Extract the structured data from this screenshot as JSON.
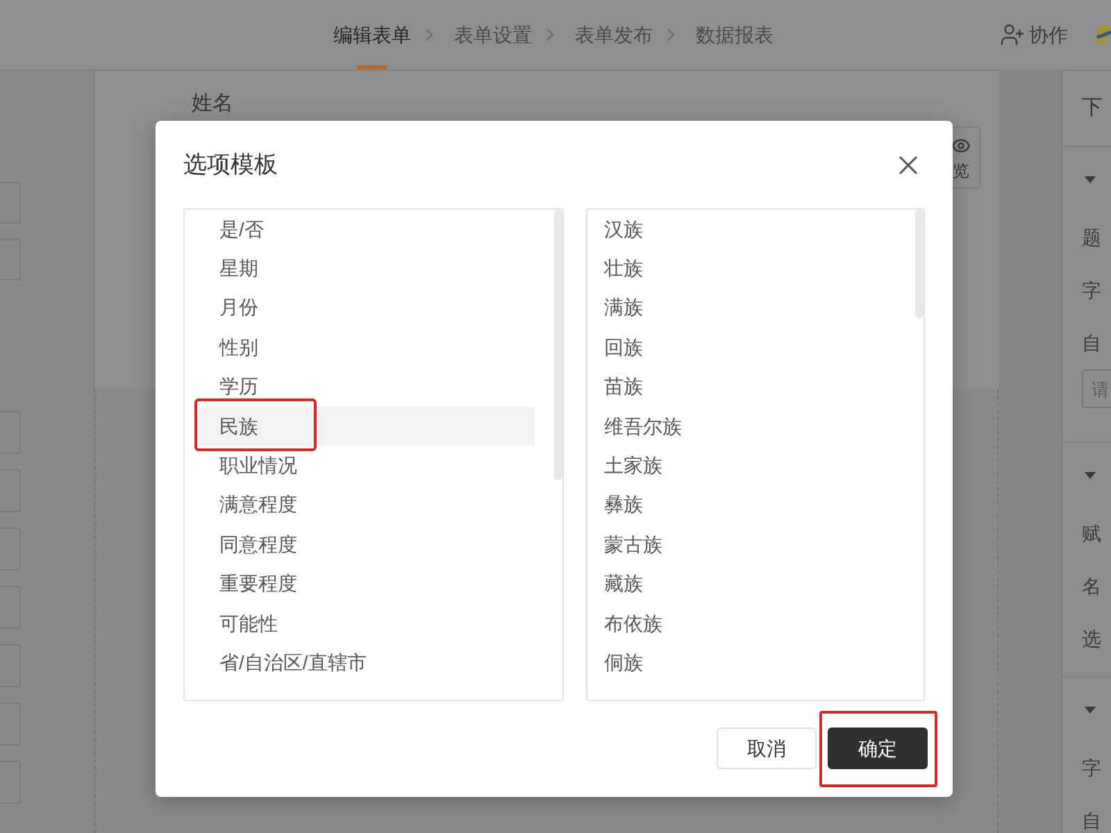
{
  "top_bar": {
    "steps": [
      {
        "label": "编辑表单",
        "selected": true
      },
      {
        "label": "表单设置",
        "selected": false
      },
      {
        "label": "表单发布",
        "selected": false
      },
      {
        "label": "数据报表",
        "selected": false
      }
    ],
    "collaborate_button": "协作"
  },
  "form_canvas": {
    "field_label": "姓名",
    "preview_button": "览"
  },
  "properties_panel": {
    "title": "下",
    "sections": [
      {
        "expanded": true,
        "rows": [
          {
            "kind": "label",
            "text": "题"
          },
          {
            "kind": "label",
            "text": "字"
          },
          {
            "kind": "label",
            "text": "自"
          },
          {
            "kind": "input",
            "placeholder": "请"
          }
        ]
      },
      {
        "expanded": true,
        "rows": [
          {
            "kind": "label",
            "text": "赋"
          },
          {
            "kind": "label",
            "text": "名"
          },
          {
            "kind": "label",
            "text": "选"
          }
        ]
      },
      {
        "expanded": true,
        "rows": [
          {
            "kind": "label",
            "text": "字"
          },
          {
            "kind": "label",
            "text": "自"
          }
        ]
      }
    ]
  },
  "dialog": {
    "title": "选项模板",
    "templates": [
      {
        "label": "是/否",
        "selected": false,
        "highlighted": false
      },
      {
        "label": "星期",
        "selected": false,
        "highlighted": false
      },
      {
        "label": "月份",
        "selected": false,
        "highlighted": false
      },
      {
        "label": "性别",
        "selected": false,
        "highlighted": false
      },
      {
        "label": "学历",
        "selected": false,
        "highlighted": false
      },
      {
        "label": "民族",
        "selected": true,
        "highlighted": true
      },
      {
        "label": "职业情况",
        "selected": false,
        "highlighted": false
      },
      {
        "label": "满意程度",
        "selected": false,
        "highlighted": false
      },
      {
        "label": "同意程度",
        "selected": false,
        "highlighted": false
      },
      {
        "label": "重要程度",
        "selected": false,
        "highlighted": false
      },
      {
        "label": "可能性",
        "selected": false,
        "highlighted": false
      },
      {
        "label": "省/自治区/直辖市",
        "selected": false,
        "highlighted": false
      }
    ],
    "options": [
      "汉族",
      "壮族",
      "满族",
      "回族",
      "苗族",
      "维吾尔族",
      "土家族",
      "彝族",
      "蒙古族",
      "藏族",
      "布依族",
      "侗族"
    ],
    "buttons": [
      {
        "label": "取消",
        "kind": "secondary",
        "highlighted": false
      },
      {
        "label": "确定",
        "kind": "primary",
        "highlighted": true
      }
    ]
  }
}
